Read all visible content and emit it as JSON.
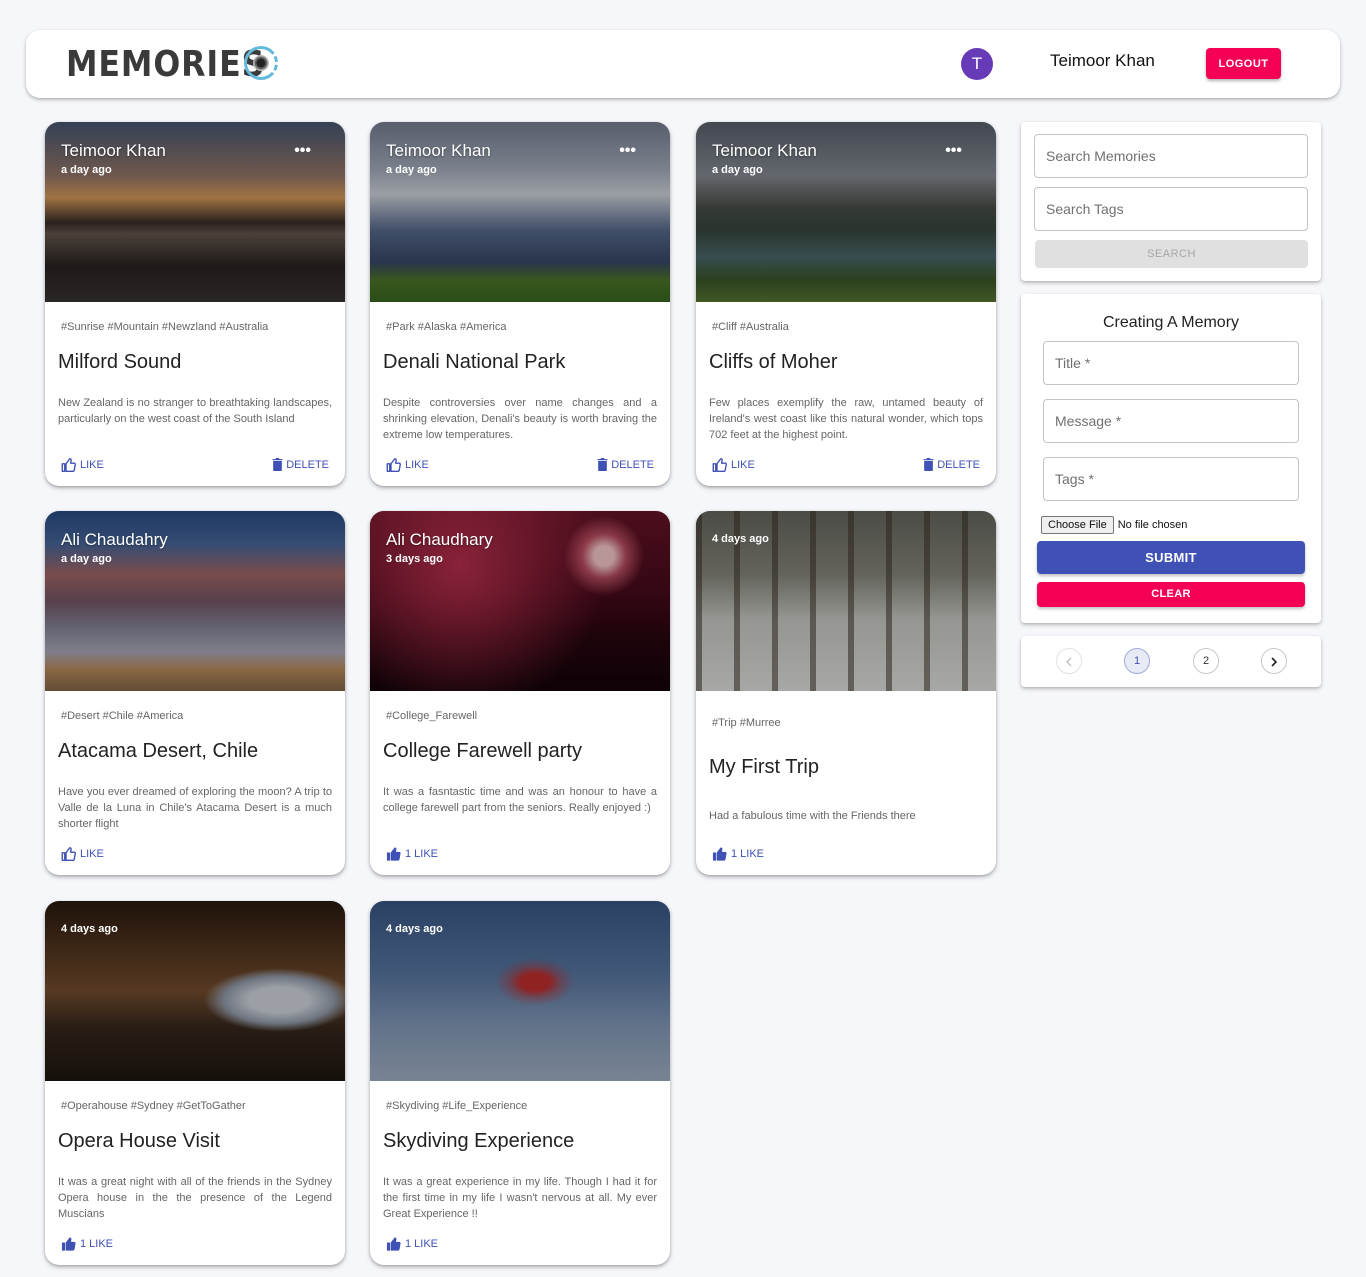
{
  "header": {
    "brand": "MEMORIES",
    "avatar_initial": "T",
    "user_name": "Teimoor Khan",
    "logout_label": "LOGOUT"
  },
  "posts": [
    {
      "author": "Teimoor Khan",
      "time": "a day ago",
      "tags": "#Sunrise #Mountain #Newzland #Australia",
      "title": "Milford Sound",
      "message": "New Zealand is no stranger to breathtaking landscapes, particularly on the west coast of the South Island",
      "like_label": "LIKE",
      "delete_label": "DELETE"
    },
    {
      "author": "Teimoor Khan",
      "time": "a day ago",
      "tags": "#Park #Alaska #America",
      "title": "Denali National Park",
      "message": "Despite controversies over name changes and a shrinking elevation, Denali's beauty is worth braving the extreme low temperatures.",
      "like_label": "LIKE",
      "delete_label": "DELETE"
    },
    {
      "author": "Teimoor Khan",
      "time": "a day ago",
      "tags": "#Cliff #Australia",
      "title": "Cliffs of Moher",
      "message": "Few places exemplify the raw, untamed beauty of Ireland's west coast like this natural wonder, which tops 702 feet at the highest point.",
      "like_label": "LIKE",
      "delete_label": "DELETE"
    },
    {
      "author": "Ali Chaudahry",
      "time": "a day ago",
      "tags": "#Desert #Chile #America",
      "title": "Atacama Desert, Chile",
      "message": "Have you ever dreamed of exploring the moon? A trip to Valle de la Luna in Chile's Atacama Desert is a much shorter flight",
      "like_label": "LIKE"
    },
    {
      "author": "Ali Chaudhary",
      "time": "3 days ago",
      "tags": "#College_Farewell",
      "title": "College Farewell party",
      "message": "It was a fasntastic time and was an honour to have a college farewell part from the seniors. Really enjoyed :)",
      "like_label": "1 LIKE"
    },
    {
      "author": "",
      "time": "4 days ago",
      "tags": "#Trip #Murree",
      "title": "My First Trip",
      "message": "Had a fabulous time with the Friends there",
      "like_label": "1 LIKE"
    },
    {
      "author": "",
      "time": "4 days ago",
      "tags": "#Operahouse #Sydney #GetToGather",
      "title": "Opera House Visit",
      "message": "It was a great night with all of the friends in the Sydney Opera house in the the presence of the Legend Muscians",
      "like_label": "1 LIKE"
    },
    {
      "author": "",
      "time": "4 days ago",
      "tags": "#Skydiving #Life_Experience",
      "title": "Skydiving Experience",
      "message": "It was a great experience in my life. Though I had it for the first time in my life I wasn't nervous at all. My ever Great Experience !!",
      "like_label": "1 LIKE"
    }
  ],
  "search": {
    "memories_placeholder": "Search Memories",
    "tags_placeholder": "Search Tags",
    "button_label": "SEARCH"
  },
  "form": {
    "heading": "Creating A Memory",
    "title_label": "Title *",
    "message_label": "Message *",
    "tags_label": "Tags *",
    "file_button": "Choose File",
    "file_status": "No file chosen",
    "submit_label": "SUBMIT",
    "clear_label": "CLEAR"
  },
  "pagination": {
    "pages": [
      "1",
      "2"
    ],
    "current": "1"
  },
  "colors": {
    "primary": "#3f51b5",
    "secondary": "#f50057",
    "avatar": "#673ab7",
    "background": "#f6f7fb"
  }
}
